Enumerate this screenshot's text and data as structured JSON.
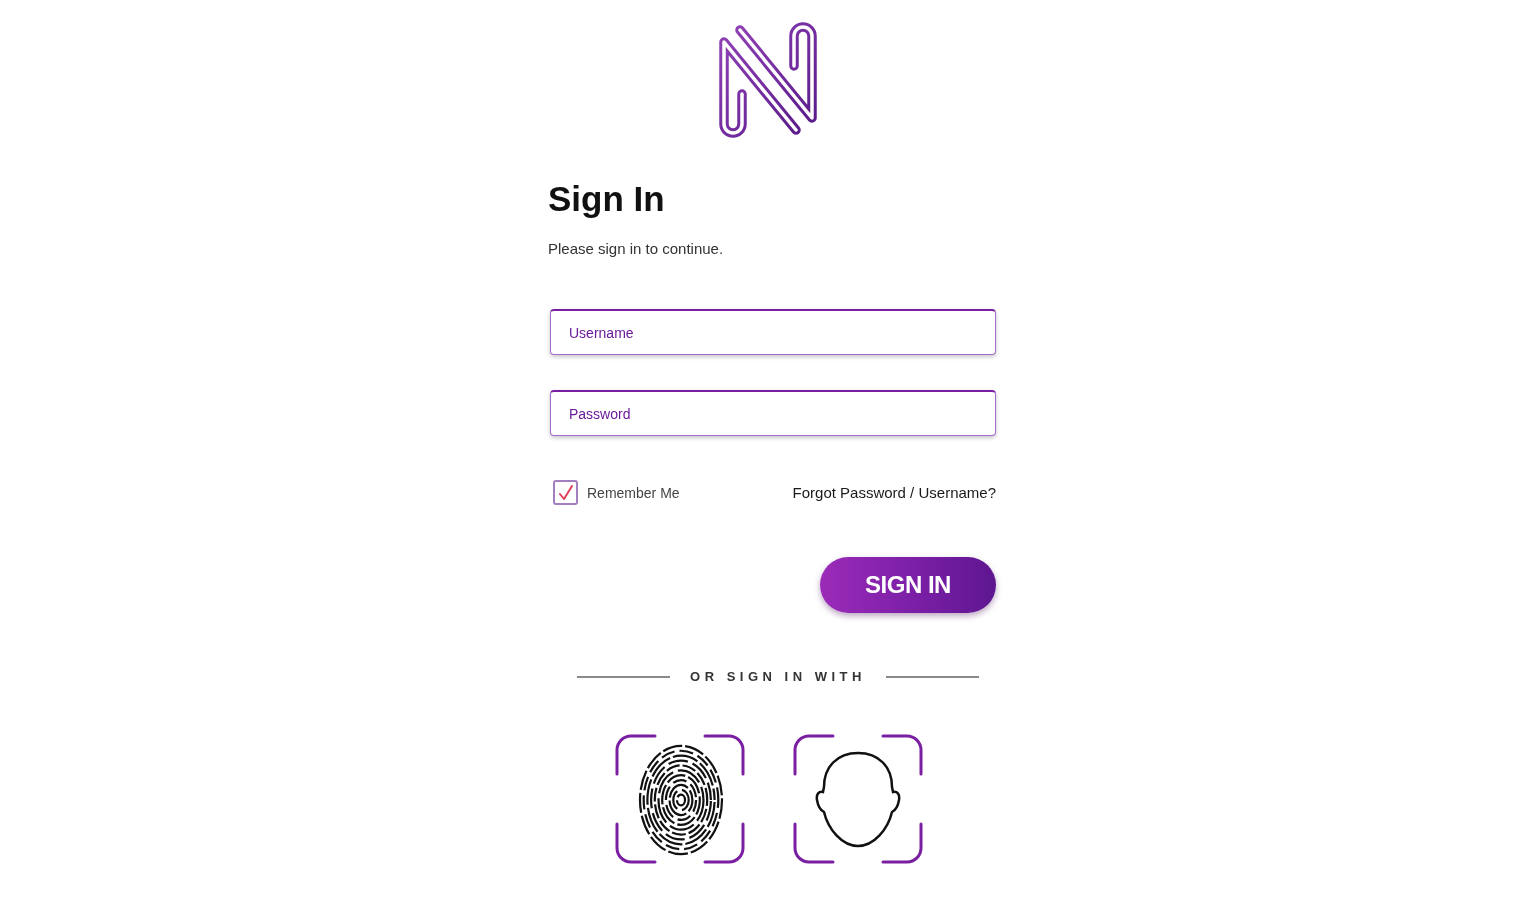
{
  "heading": "Sign In",
  "subtitle": "Please sign in to continue.",
  "fields": [
    {
      "placeholder": "Username"
    },
    {
      "placeholder": "Password"
    }
  ],
  "remember_me": {
    "label": "Remember Me",
    "checked": true
  },
  "forgot_link": "Forgot Password / Username?",
  "sign_in_button": "SIGN IN",
  "divider": "OR SIGN IN WITH",
  "alt_methods": [
    {
      "kind": "fingerprint"
    },
    {
      "kind": "face"
    }
  ]
}
